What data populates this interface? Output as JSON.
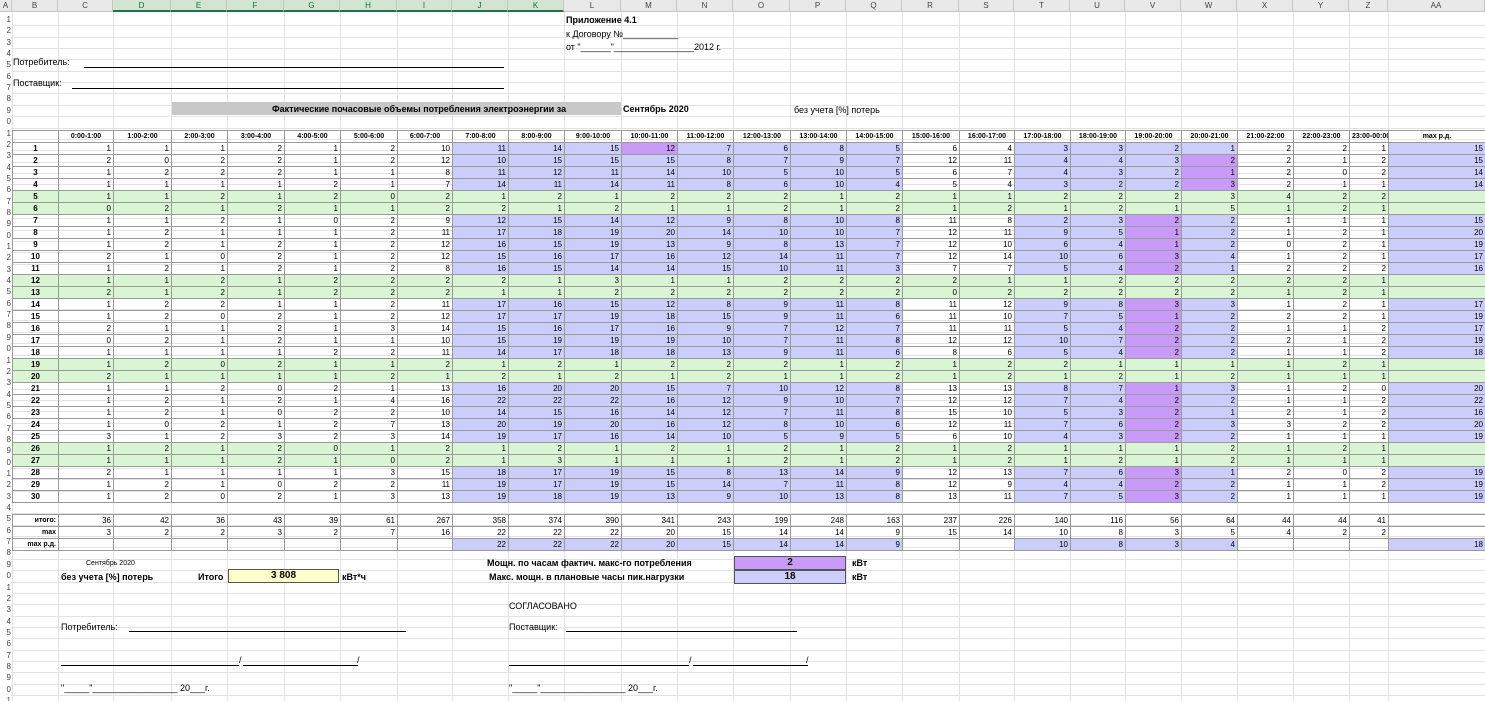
{
  "columns": [
    "A",
    "B",
    "C",
    "D",
    "E",
    "F",
    "G",
    "H",
    "I",
    "J",
    "K",
    "L",
    "M",
    "N",
    "O",
    "P",
    "Q",
    "R",
    "S",
    "T",
    "U",
    "V",
    "W",
    "X",
    "Y",
    "Z",
    "AA"
  ],
  "row_numbers": [
    "1",
    "2",
    "3",
    "4",
    "5",
    "6",
    "7",
    "8",
    "9",
    "0",
    "1",
    "2",
    "3",
    "4",
    "5",
    "6",
    "7",
    "8",
    "9",
    "0",
    "1",
    "2",
    "3",
    "4",
    "5",
    "6",
    "7",
    "8",
    "9",
    "0",
    "1",
    "2",
    "3",
    "4",
    "5",
    "6",
    "7",
    "8",
    "9",
    "0",
    "1",
    "2",
    "3",
    "4",
    "5",
    "6",
    "7",
    "8",
    "9",
    "0",
    "1",
    "2",
    "3",
    "4",
    "5",
    "6",
    "7",
    "8",
    "9",
    "0",
    "1"
  ],
  "header": {
    "annex": "Приложение 4.1",
    "contract": "к Договору №___________",
    "date": "от \"______\"________________2012 г.",
    "consumer": "Потребитель:",
    "supplier": "Поставщик:",
    "title": "Фактические почасовые объемы потребления электроэнергии за",
    "month": "Сентябрь 2020",
    "note": "без учета [%] потерь"
  },
  "table": {
    "hours": [
      "0:00-1:00",
      "1:00-2:00",
      "2:00-3:00",
      "3:00-4:00",
      "4:00-5:00",
      "5:00-6:00",
      "6:00-7:00",
      "7:00-8:00",
      "8:00-9:00",
      "9:00-10:00",
      "10:00-11:00",
      "11:00-12:00",
      "12:00-13:00",
      "13:00-14:00",
      "14:00-15:00",
      "15:00-16:00",
      "16:00-17:00",
      "17:00-18:00",
      "18:00-19:00",
      "19:00-20:00",
      "20:00-21:00",
      "21:00-22:00",
      "22:00-23:00",
      "23:00-00:00"
    ],
    "max_label": "max р.д.",
    "days": [
      {
        "d": "1",
        "we": false,
        "v": [
          "1",
          "1",
          "1",
          "2",
          "1",
          "2",
          "10",
          "11",
          "14",
          "15",
          "12",
          "7",
          "6",
          "8",
          "5",
          "6",
          "4",
          "3",
          "3",
          "2",
          "1",
          "2",
          "2",
          "1"
        ],
        "mx": "15",
        "mxc": 10
      },
      {
        "d": "2",
        "we": false,
        "v": [
          "2",
          "0",
          "2",
          "2",
          "1",
          "2",
          "12",
          "10",
          "15",
          "15",
          "15",
          "8",
          "7",
          "9",
          "7",
          "12",
          "11",
          "4",
          "4",
          "3",
          "2",
          "2",
          "1",
          "2"
        ],
        "mx": "15",
        "mxc": 20
      },
      {
        "d": "3",
        "we": false,
        "v": [
          "1",
          "2",
          "2",
          "2",
          "1",
          "1",
          "8",
          "11",
          "12",
          "11",
          "14",
          "10",
          "5",
          "10",
          "5",
          "6",
          "7",
          "4",
          "3",
          "2",
          "1",
          "2",
          "0",
          "2"
        ],
        "mx": "14",
        "mxc": 20
      },
      {
        "d": "4",
        "we": false,
        "v": [
          "1",
          "1",
          "1",
          "1",
          "2",
          "1",
          "7",
          "14",
          "11",
          "14",
          "11",
          "8",
          "6",
          "10",
          "4",
          "5",
          "4",
          "3",
          "2",
          "2",
          "3",
          "2",
          "1",
          "1"
        ],
        "mx": "14",
        "mxc": 20
      },
      {
        "d": "5",
        "we": true,
        "v": [
          "1",
          "1",
          "2",
          "1",
          "2",
          "0",
          "2",
          "1",
          "2",
          "1",
          "2",
          "2",
          "2",
          "1",
          "2",
          "1",
          "1",
          "2",
          "2",
          "2",
          "3",
          "4",
          "2",
          "2"
        ],
        "mx": "",
        "mxc": -1
      },
      {
        "d": "6",
        "we": true,
        "v": [
          "0",
          "2",
          "1",
          "2",
          "1",
          "1",
          "2",
          "2",
          "1",
          "2",
          "1",
          "1",
          "2",
          "1",
          "2",
          "1",
          "2",
          "1",
          "2",
          "1",
          "5",
          "1",
          "2",
          "1"
        ],
        "mx": "",
        "mxc": -1
      },
      {
        "d": "7",
        "we": false,
        "v": [
          "1",
          "1",
          "2",
          "1",
          "0",
          "2",
          "9",
          "12",
          "15",
          "14",
          "12",
          "9",
          "8",
          "10",
          "8",
          "11",
          "8",
          "2",
          "3",
          "2",
          "2",
          "1",
          "1",
          "1"
        ],
        "mx": "15",
        "mxc": 19
      },
      {
        "d": "8",
        "we": false,
        "v": [
          "1",
          "2",
          "1",
          "1",
          "1",
          "2",
          "11",
          "17",
          "18",
          "19",
          "20",
          "14",
          "10",
          "10",
          "7",
          "12",
          "11",
          "9",
          "5",
          "1",
          "2",
          "1",
          "2",
          "1"
        ],
        "mx": "20",
        "mxc": 19
      },
      {
        "d": "9",
        "we": false,
        "v": [
          "1",
          "2",
          "1",
          "2",
          "1",
          "2",
          "12",
          "16",
          "15",
          "19",
          "13",
          "9",
          "8",
          "13",
          "7",
          "12",
          "10",
          "6",
          "4",
          "1",
          "2",
          "0",
          "2",
          "1"
        ],
        "mx": "19",
        "mxc": 19
      },
      {
        "d": "10",
        "we": false,
        "v": [
          "2",
          "1",
          "0",
          "2",
          "1",
          "2",
          "12",
          "15",
          "16",
          "17",
          "16",
          "12",
          "14",
          "11",
          "7",
          "12",
          "14",
          "10",
          "6",
          "3",
          "4",
          "1",
          "2",
          "1"
        ],
        "mx": "17",
        "mxc": 19
      },
      {
        "d": "11",
        "we": false,
        "v": [
          "1",
          "2",
          "1",
          "2",
          "1",
          "2",
          "8",
          "16",
          "15",
          "14",
          "14",
          "15",
          "10",
          "11",
          "3",
          "7",
          "7",
          "5",
          "4",
          "2",
          "1",
          "2",
          "2",
          "2"
        ],
        "mx": "16",
        "mxc": 19
      },
      {
        "d": "12",
        "we": true,
        "v": [
          "1",
          "1",
          "2",
          "1",
          "2",
          "2",
          "2",
          "2",
          "1",
          "3",
          "1",
          "1",
          "2",
          "2",
          "2",
          "2",
          "1",
          "1",
          "2",
          "2",
          "2",
          "2",
          "2",
          "1"
        ],
        "mx": "",
        "mxc": -1
      },
      {
        "d": "13",
        "we": true,
        "v": [
          "2",
          "1",
          "2",
          "1",
          "2",
          "2",
          "2",
          "1",
          "1",
          "2",
          "2",
          "2",
          "2",
          "2",
          "2",
          "0",
          "2",
          "2",
          "2",
          "2",
          "2",
          "1",
          "2",
          "1"
        ],
        "mx": "",
        "mxc": -1
      },
      {
        "d": "14",
        "we": false,
        "v": [
          "1",
          "2",
          "2",
          "1",
          "1",
          "2",
          "11",
          "17",
          "16",
          "15",
          "12",
          "8",
          "9",
          "11",
          "8",
          "11",
          "12",
          "9",
          "8",
          "3",
          "3",
          "1",
          "2",
          "1"
        ],
        "mx": "17",
        "mxc": 19
      },
      {
        "d": "15",
        "we": false,
        "v": [
          "1",
          "2",
          "0",
          "2",
          "1",
          "2",
          "12",
          "17",
          "17",
          "19",
          "18",
          "15",
          "9",
          "11",
          "6",
          "11",
          "10",
          "7",
          "5",
          "1",
          "2",
          "2",
          "2",
          "1"
        ],
        "mx": "19",
        "mxc": 19
      },
      {
        "d": "16",
        "we": false,
        "v": [
          "2",
          "1",
          "1",
          "2",
          "1",
          "3",
          "14",
          "15",
          "16",
          "17",
          "16",
          "9",
          "7",
          "12",
          "7",
          "11",
          "11",
          "5",
          "4",
          "2",
          "2",
          "1",
          "1",
          "2"
        ],
        "mx": "17",
        "mxc": 19
      },
      {
        "d": "17",
        "we": false,
        "v": [
          "0",
          "2",
          "1",
          "2",
          "1",
          "1",
          "10",
          "15",
          "19",
          "19",
          "19",
          "10",
          "7",
          "11",
          "8",
          "12",
          "12",
          "10",
          "7",
          "2",
          "2",
          "2",
          "1",
          "2"
        ],
        "mx": "19",
        "mxc": 19
      },
      {
        "d": "18",
        "we": false,
        "v": [
          "1",
          "1",
          "1",
          "1",
          "2",
          "2",
          "11",
          "14",
          "17",
          "18",
          "18",
          "13",
          "9",
          "11",
          "6",
          "8",
          "6",
          "5",
          "4",
          "2",
          "2",
          "1",
          "1",
          "2"
        ],
        "mx": "18",
        "mxc": 19
      },
      {
        "d": "19",
        "we": true,
        "v": [
          "1",
          "2",
          "0",
          "2",
          "1",
          "1",
          "2",
          "1",
          "2",
          "1",
          "2",
          "2",
          "2",
          "1",
          "2",
          "1",
          "2",
          "2",
          "1",
          "1",
          "1",
          "1",
          "2",
          "1"
        ],
        "mx": "",
        "mxc": -1
      },
      {
        "d": "20",
        "we": true,
        "v": [
          "2",
          "1",
          "1",
          "1",
          "1",
          "2",
          "1",
          "2",
          "1",
          "2",
          "1",
          "2",
          "1",
          "1",
          "2",
          "1",
          "2",
          "1",
          "2",
          "1",
          "2",
          "1",
          "1",
          "1"
        ],
        "mx": "",
        "mxc": -1
      },
      {
        "d": "21",
        "we": false,
        "v": [
          "1",
          "1",
          "2",
          "0",
          "2",
          "1",
          "13",
          "16",
          "20",
          "20",
          "15",
          "7",
          "10",
          "12",
          "8",
          "13",
          "13",
          "8",
          "7",
          "1",
          "3",
          "1",
          "2",
          "0"
        ],
        "mx": "20",
        "mxc": 19
      },
      {
        "d": "22",
        "we": false,
        "v": [
          "1",
          "2",
          "1",
          "2",
          "1",
          "4",
          "16",
          "22",
          "22",
          "22",
          "16",
          "12",
          "9",
          "10",
          "7",
          "12",
          "12",
          "7",
          "4",
          "2",
          "2",
          "1",
          "1",
          "2"
        ],
        "mx": "22",
        "mxc": 19
      },
      {
        "d": "23",
        "we": false,
        "v": [
          "1",
          "2",
          "1",
          "0",
          "2",
          "2",
          "10",
          "14",
          "15",
          "16",
          "14",
          "12",
          "7",
          "11",
          "8",
          "15",
          "10",
          "5",
          "3",
          "2",
          "1",
          "2",
          "1",
          "2"
        ],
        "mx": "16",
        "mxc": 19
      },
      {
        "d": "24",
        "we": false,
        "v": [
          "1",
          "0",
          "2",
          "1",
          "2",
          "7",
          "13",
          "20",
          "19",
          "20",
          "16",
          "12",
          "8",
          "10",
          "6",
          "12",
          "11",
          "7",
          "6",
          "2",
          "3",
          "3",
          "2",
          "2"
        ],
        "mx": "20",
        "mxc": 19
      },
      {
        "d": "25",
        "we": false,
        "v": [
          "3",
          "1",
          "2",
          "3",
          "2",
          "3",
          "14",
          "19",
          "17",
          "16",
          "14",
          "10",
          "5",
          "9",
          "5",
          "6",
          "10",
          "4",
          "3",
          "2",
          "2",
          "1",
          "1",
          "1"
        ],
        "mx": "19",
        "mxc": 19
      },
      {
        "d": "26",
        "we": true,
        "v": [
          "1",
          "2",
          "1",
          "2",
          "0",
          "1",
          "2",
          "1",
          "2",
          "1",
          "2",
          "1",
          "2",
          "1",
          "2",
          "1",
          "2",
          "1",
          "1",
          "1",
          "2",
          "1",
          "2",
          "1"
        ],
        "mx": "",
        "mxc": -1
      },
      {
        "d": "27",
        "we": true,
        "v": [
          "1",
          "1",
          "1",
          "2",
          "1",
          "0",
          "2",
          "1",
          "3",
          "1",
          "1",
          "1",
          "2",
          "1",
          "2",
          "1",
          "2",
          "1",
          "2",
          "1",
          "2",
          "1",
          "1",
          "1"
        ],
        "mx": "",
        "mxc": -1
      },
      {
        "d": "28",
        "we": false,
        "v": [
          "2",
          "1",
          "1",
          "1",
          "1",
          "3",
          "15",
          "18",
          "17",
          "19",
          "15",
          "8",
          "13",
          "14",
          "9",
          "12",
          "13",
          "7",
          "6",
          "3",
          "1",
          "2",
          "0",
          "2"
        ],
        "mx": "19",
        "mxc": 19
      },
      {
        "d": "29",
        "we": false,
        "v": [
          "1",
          "2",
          "1",
          "0",
          "2",
          "2",
          "11",
          "19",
          "17",
          "19",
          "15",
          "14",
          "7",
          "11",
          "8",
          "12",
          "9",
          "4",
          "4",
          "2",
          "2",
          "1",
          "1",
          "2"
        ],
        "mx": "19",
        "mxc": 19
      },
      {
        "d": "30",
        "we": false,
        "v": [
          "1",
          "2",
          "0",
          "2",
          "1",
          "3",
          "13",
          "19",
          "18",
          "19",
          "13",
          "9",
          "10",
          "13",
          "8",
          "13",
          "11",
          "7",
          "5",
          "3",
          "2",
          "1",
          "1",
          "1"
        ],
        "mx": "19",
        "mxc": 19
      }
    ],
    "totals_label": "итого:",
    "totals": [
      "36",
      "42",
      "36",
      "43",
      "39",
      "61",
      "267",
      "358",
      "374",
      "390",
      "341",
      "243",
      "199",
      "248",
      "163",
      "237",
      "226",
      "140",
      "116",
      "56",
      "64",
      "44",
      "44",
      "41"
    ],
    "max_label2": "max",
    "max_row": [
      "3",
      "2",
      "2",
      "3",
      "2",
      "7",
      "16",
      "22",
      "22",
      "22",
      "20",
      "15",
      "14",
      "14",
      "9",
      "15",
      "14",
      "10",
      "8",
      "3",
      "5",
      "4",
      "2",
      "2"
    ],
    "maxrd_label": "max р.д.",
    "maxrd_row": [
      "",
      "",
      "",
      "",
      "",
      "",
      "",
      "22",
      "22",
      "22",
      "20",
      "15",
      "14",
      "14",
      "9",
      "",
      "",
      "10",
      "8",
      "3",
      "4",
      "",
      "",
      ""
    ],
    "maxrd_total": "18"
  },
  "summary": {
    "month": "Сентябрь 2020",
    "note": "без учета [%] потерь",
    "total_label": "Итого",
    "total_value": "3 808",
    "total_unit": "кВт*ч",
    "power_label": "Мощн. по часам фактич. макс-го потребления",
    "power_value": "2",
    "power_unit": "кВт",
    "peak_label": "Макс. мощн. в плановые часы пик.нагрузки",
    "peak_value": "18",
    "peak_unit": "кВт"
  },
  "footer": {
    "agreed": "СОГЛАСОВАНО",
    "consumer": "Потребитель:",
    "supplier": "Поставщик:",
    "slash": "/",
    "slash2": "/",
    "date_left": "\"_____\"_________________ 20___г.",
    "date_right": "\"_____\"_________________ 20___г."
  },
  "colors": {
    "weekend": "#d9f5d3",
    "peak": "#cbcdfa",
    "max": "#c79bf7",
    "highlight": "#ffffcc",
    "header": "#c8c8c8"
  }
}
